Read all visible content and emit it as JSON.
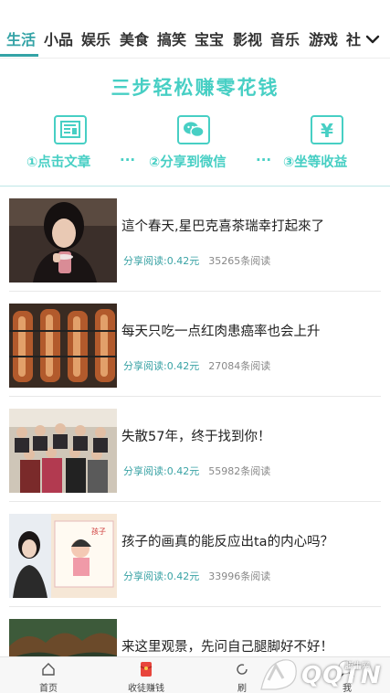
{
  "tabs": [
    "生活",
    "小品",
    "娱乐",
    "美食",
    "搞笑",
    "宝宝",
    "影视",
    "音乐",
    "游戏",
    "社"
  ],
  "banner": {
    "title": "三步轻松赚零花钱",
    "steps": [
      "①点击文章",
      "②分享到微信",
      "③坐等收益"
    ],
    "dots": "···",
    "icons": [
      "article-icon",
      "wechat-icon",
      "yen-icon"
    ],
    "yen_glyph": "¥"
  },
  "articles": [
    {
      "title": "這个春天,星巴克喜茶瑞幸打起來了",
      "share": "分享阅读:0.42元",
      "reads": "35265条阅读"
    },
    {
      "title": "每天只吃一点红肉患癌率也会上升",
      "share": "分享阅读:0.42元",
      "reads": "27084条阅读"
    },
    {
      "title": "失散57年，终于找到你！",
      "share": "分享阅读:0.42元",
      "reads": "55982条阅读"
    },
    {
      "title": "孩子的画真的能反应出ta的内心吗？",
      "share": "分享阅读:0.42元",
      "reads": "33996条阅读"
    },
    {
      "title": "来这里观景，先问自己腿脚好不好！",
      "share": "",
      "reads": ""
    }
  ],
  "bottom_nav": {
    "home": "首页",
    "invite": "收徒赚钱",
    "refresh": "刷",
    "mine": "我"
  },
  "watermark": {
    "text": "QQTN",
    "small": "腾牛网"
  },
  "colors": {
    "accent": "#47cfc4",
    "tab_active": "#34a3a6",
    "share": "#3aa3a5"
  }
}
